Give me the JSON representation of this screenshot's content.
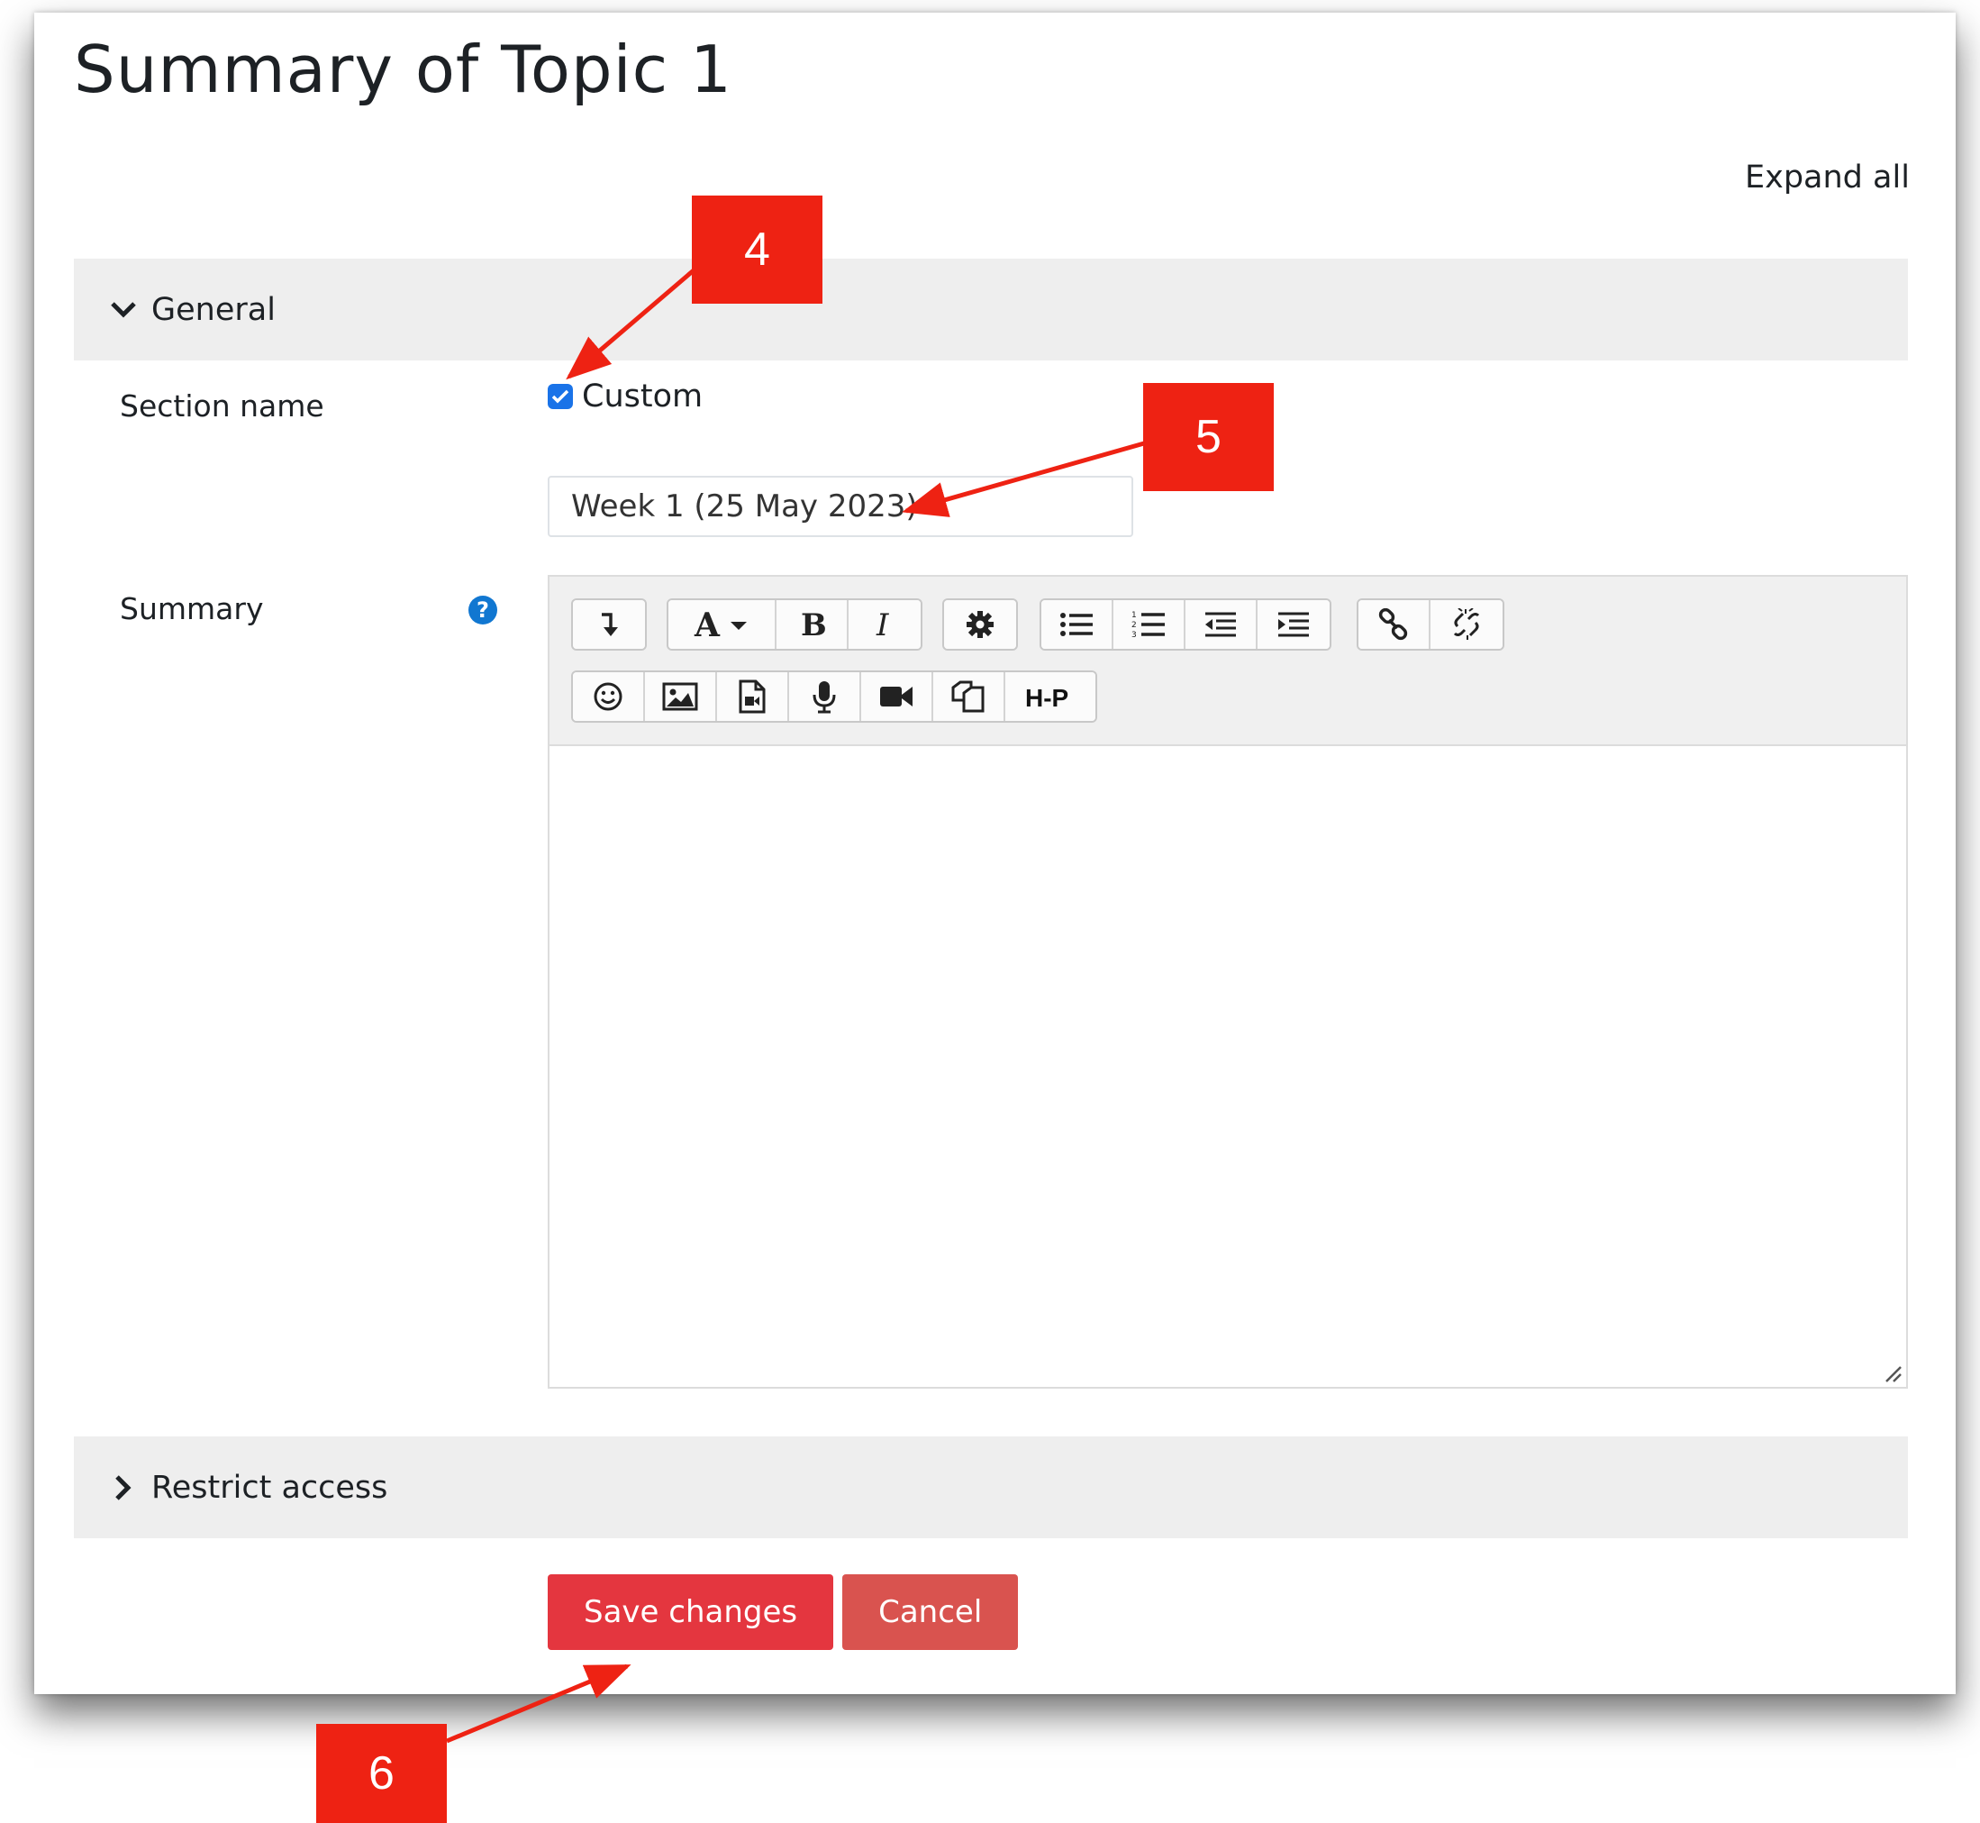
{
  "page": {
    "title": "Summary of Topic 1",
    "expand_all": "Expand all"
  },
  "sections": {
    "general": "General",
    "restrict_access": "Restrict access"
  },
  "form": {
    "section_name_label": "Section name",
    "custom_label": "Custom",
    "custom_checked": true,
    "section_name_value": "Week 1 (25 May 2023)",
    "summary_label": "Summary",
    "help_glyph": "?"
  },
  "editor": {
    "toolbar_row1": [
      [
        "collapse-icon"
      ],
      [
        "font-style-icon",
        "bold-icon",
        "italic-icon"
      ],
      [
        "equation-icon"
      ],
      [
        "unordered-list-icon",
        "ordered-list-icon",
        "outdent-icon",
        "indent-icon"
      ],
      [
        "link-icon",
        "unlink-icon"
      ]
    ],
    "toolbar_row2": [
      [
        "emoji-icon",
        "image-icon",
        "media-icon",
        "record-audio-icon",
        "record-video-icon",
        "manage-files-icon",
        "h5p-icon"
      ]
    ],
    "h5p_text": "H-P"
  },
  "actions": {
    "save": "Save changes",
    "cancel": "Cancel"
  },
  "annotations": [
    "4",
    "5",
    "6"
  ],
  "colors": {
    "callout": "#ee2213",
    "save_button": "#e4363f",
    "cancel_button": "#d9534f",
    "checkbox": "#1a73e8"
  }
}
